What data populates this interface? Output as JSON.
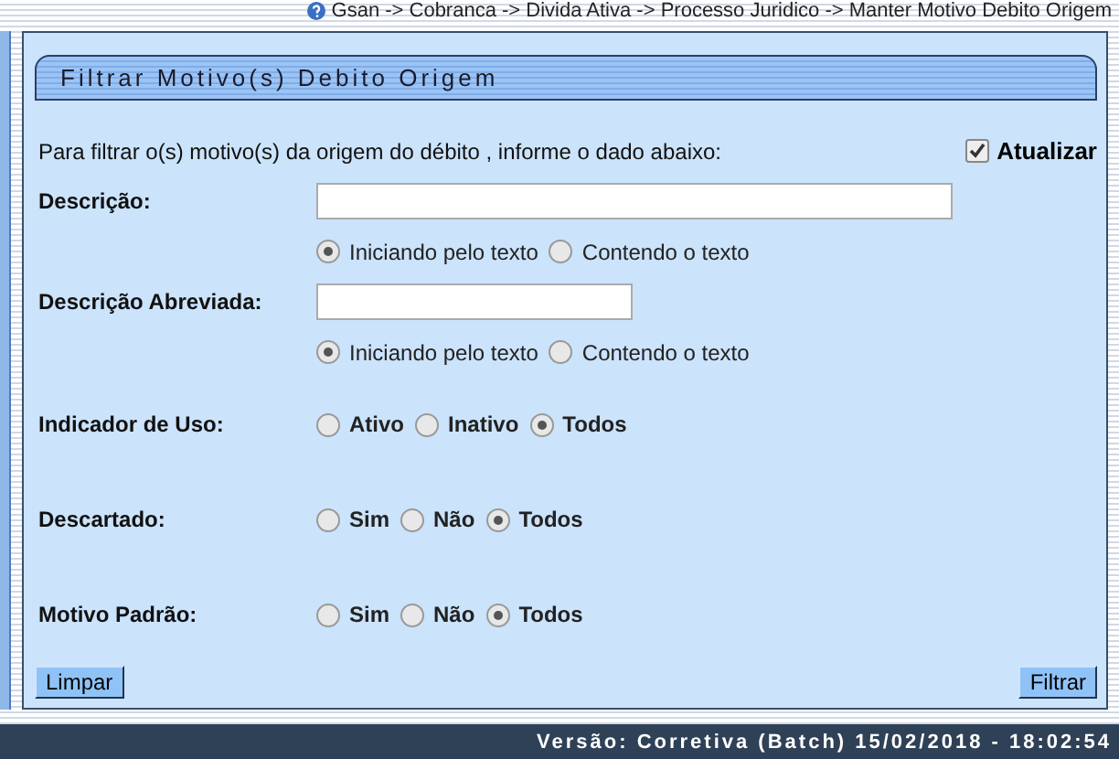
{
  "breadcrumb": "Gsan -> Cobranca -> Divida Ativa -> Processo Juridico -> Manter Motivo Debito Origem",
  "panel": {
    "title": "Filtrar Motivo(s) Debito Origem"
  },
  "intro": "Para filtrar o(s) motivo(s) da origem do débito , informe o dado abaixo:",
  "atualizar": {
    "label": "Atualizar",
    "checked": true
  },
  "rows": [
    {
      "kind": "long-text",
      "label": "Descrição:"
    },
    {
      "kind": "match",
      "options": [
        {
          "label": "Iniciando pelo texto",
          "selected": true
        },
        {
          "label": "Contendo o texto",
          "selected": false
        }
      ]
    },
    {
      "kind": "short-text",
      "label": "Descrição Abreviada:"
    },
    {
      "kind": "match",
      "options": [
        {
          "label": "Iniciando pelo texto",
          "selected": true
        },
        {
          "label": "Contendo o texto",
          "selected": false
        }
      ]
    },
    {
      "kind": "choice",
      "label": "Indicador de Uso:",
      "options": [
        {
          "label": "Ativo",
          "selected": false
        },
        {
          "label": "Inativo",
          "selected": false
        },
        {
          "label": "Todos",
          "selected": true
        }
      ]
    },
    {
      "kind": "choice",
      "label": "Descartado:",
      "options": [
        {
          "label": "Sim",
          "selected": false
        },
        {
          "label": "Não",
          "selected": false
        },
        {
          "label": "Todos",
          "selected": true
        }
      ]
    },
    {
      "kind": "choice",
      "label": "Motivo Padrão:",
      "options": [
        {
          "label": "Sim",
          "selected": false
        },
        {
          "label": "Não",
          "selected": false
        },
        {
          "label": "Todos",
          "selected": true
        }
      ]
    }
  ],
  "buttons": {
    "clear": "Limpar",
    "filter": "Filtrar"
  },
  "footer": "Versão: Corretiva (Batch) 15/02/2018 - 18:02:54"
}
